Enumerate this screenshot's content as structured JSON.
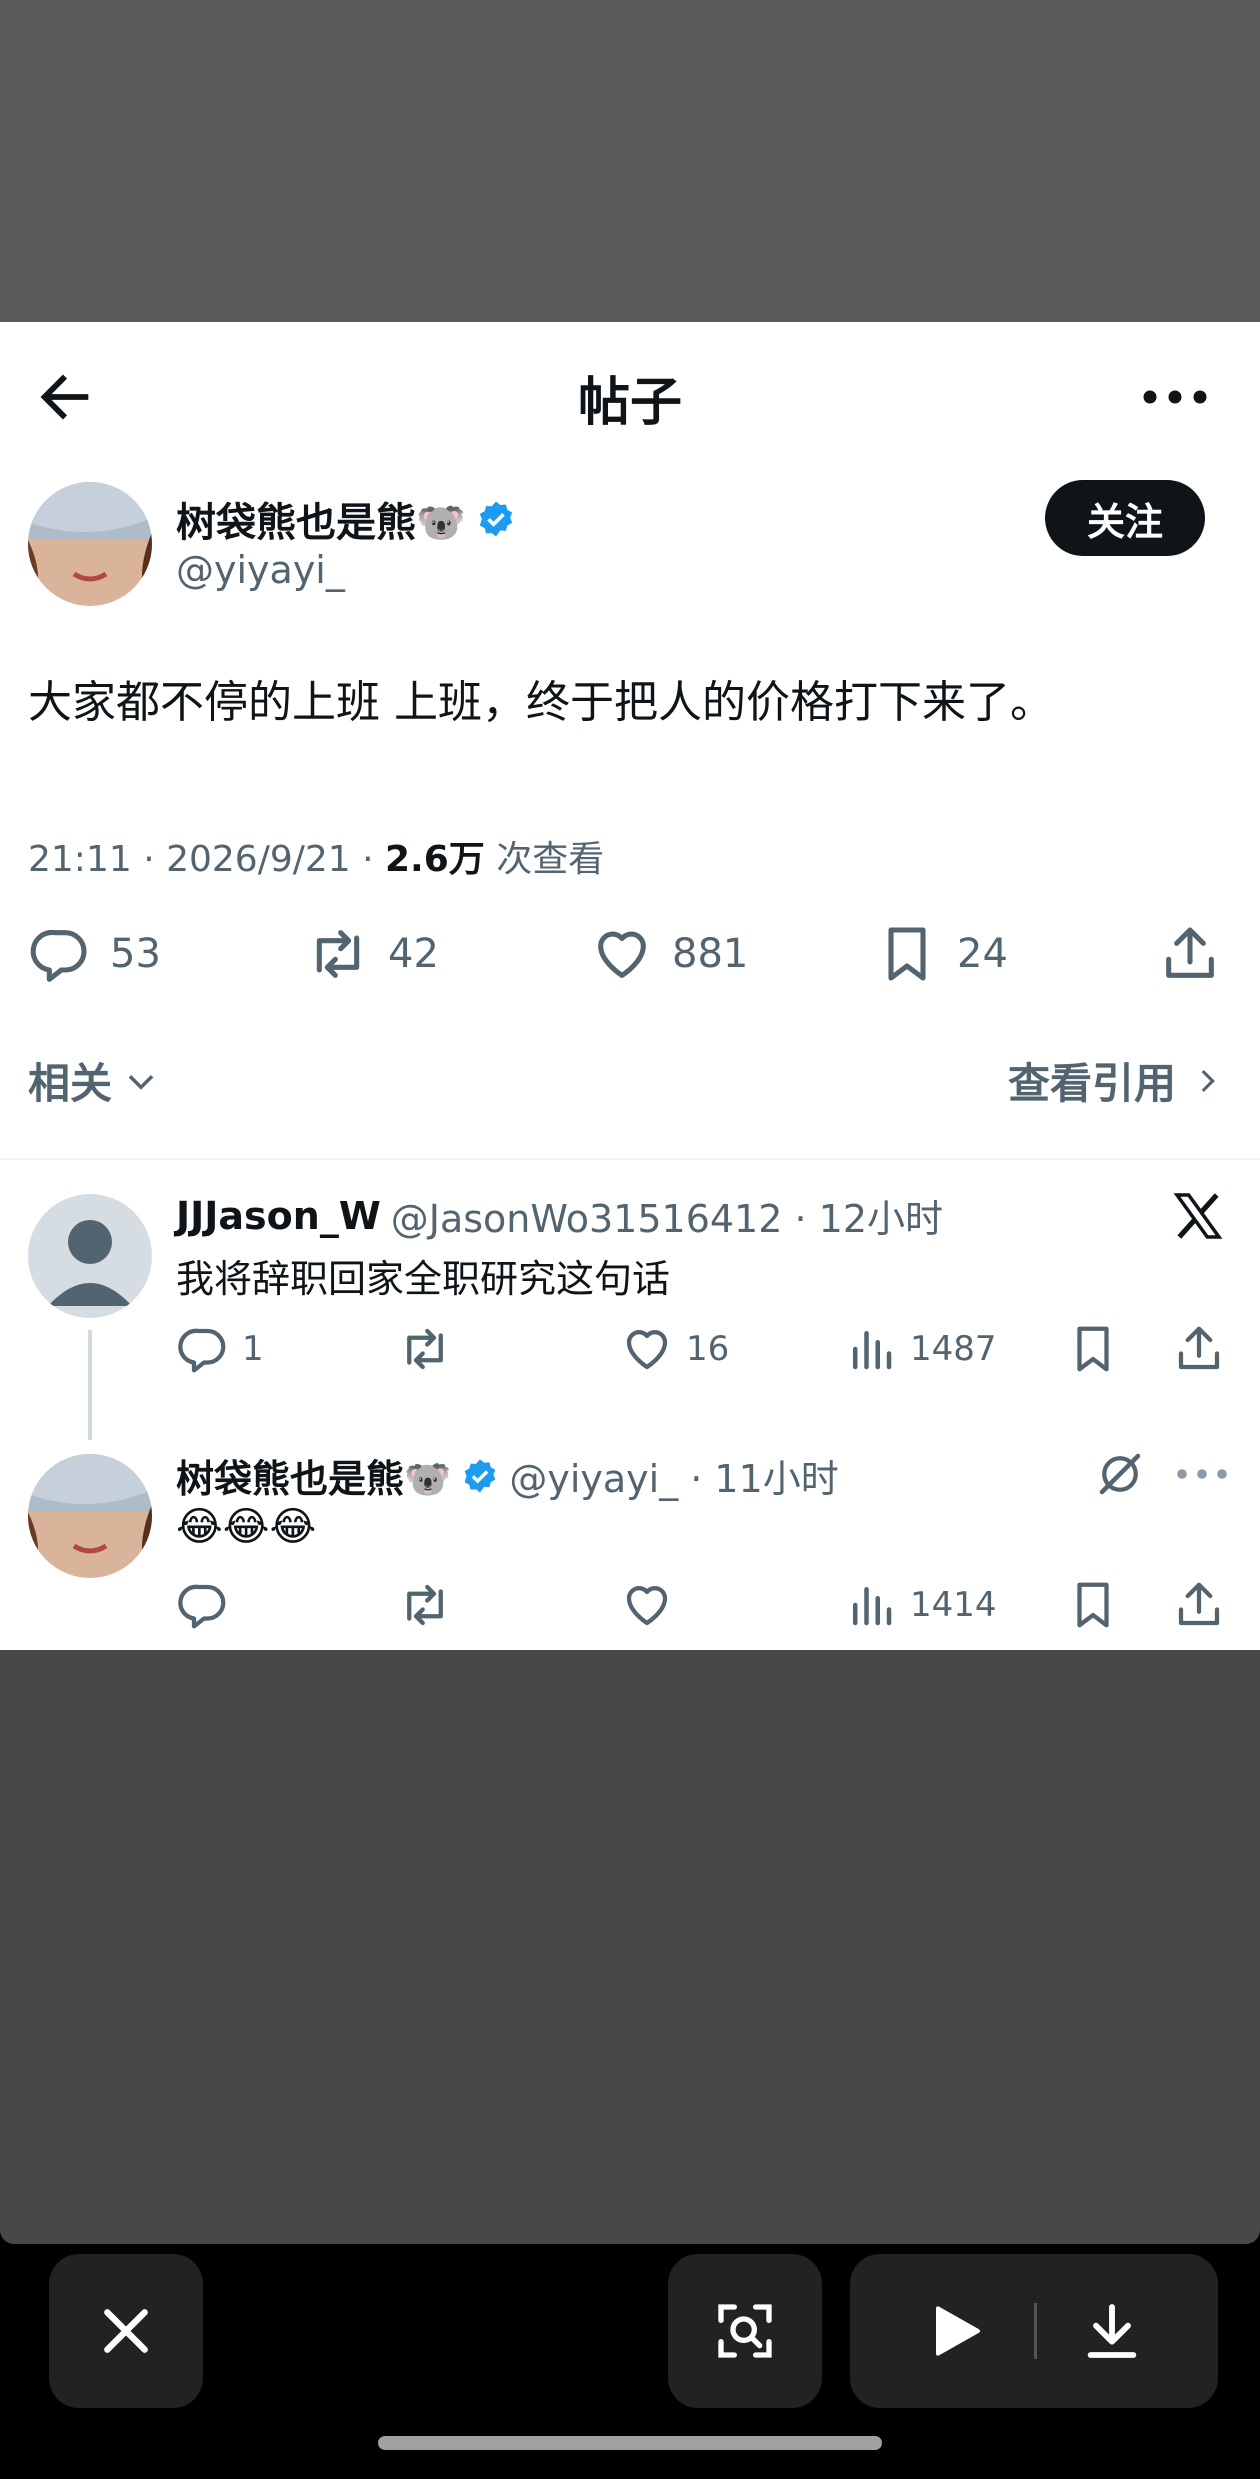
{
  "header": {
    "title": "帖子"
  },
  "post": {
    "author_name": "树袋熊也是熊🐨",
    "author_handle": "@yiyayi_",
    "follow_label": "关注",
    "text": "大家都不停的上班 上班，终于把人的价格打下来了。",
    "time": "21:11 · 2026/9/21 · ",
    "views_count": "2.6万",
    "views_label": " 次查看",
    "stats": {
      "replies": "53",
      "retweets": "42",
      "likes": "881",
      "bookmarks": "24"
    }
  },
  "links": {
    "related": "相关",
    "view_quotes": "查看引用"
  },
  "replies": [
    {
      "name": "JJJason_W",
      "handle_time": "@JasonWo31516412 · 12小时",
      "text": "我将辞职回家全职研究这句话",
      "replies": "1",
      "retweets": "",
      "likes": "16",
      "views": "1487"
    },
    {
      "name": "树袋熊也是熊🐨",
      "handle_time": "@yiyayi_ · 11小时",
      "text": "😂😂😂",
      "replies": "",
      "retweets": "",
      "likes": "",
      "views": "1414"
    }
  ],
  "colors": {
    "accent_blue": "#1d9bf0",
    "text_primary": "#0f1419",
    "text_secondary": "#536471"
  },
  "icons": [
    "back-arrow-icon",
    "more-icon",
    "verified-badge-icon",
    "reply-icon",
    "retweet-icon",
    "like-icon",
    "bookmark-icon",
    "share-icon",
    "chevron-down-icon",
    "chevron-right-icon",
    "x-logo-icon",
    "views-icon",
    "grok-icon",
    "close-icon",
    "scan-icon",
    "play-icon",
    "download-icon"
  ]
}
